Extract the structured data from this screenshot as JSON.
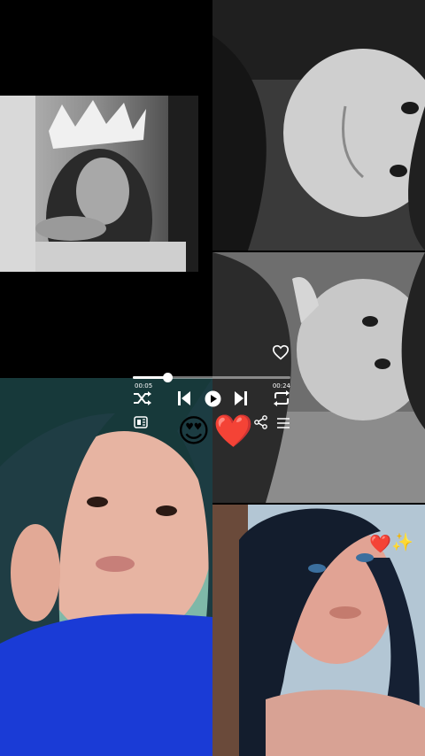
{
  "player": {
    "elapsed": "00:05",
    "total": "00:24",
    "progress": 0.22
  },
  "controls": {
    "shuffle_icon": "shuffle-icon",
    "previous_icon": "skip-previous-icon",
    "play_icon": "play-icon",
    "next_icon": "skip-next-icon",
    "repeat_icon": "repeat-icon",
    "lyrics_icon": "lyrics-icon",
    "share_icon": "share-icon",
    "queue_icon": "queue-icon",
    "like_icon": "heart-outline-icon"
  },
  "stickers": {
    "heart_eyes": "😍",
    "red_heart": "❤️",
    "small_heart": "❤️",
    "sparkles": "✨"
  },
  "colors": {
    "background": "#000000",
    "accent_white": "#ffffff",
    "blue_shirt": "#1a3bd6"
  }
}
